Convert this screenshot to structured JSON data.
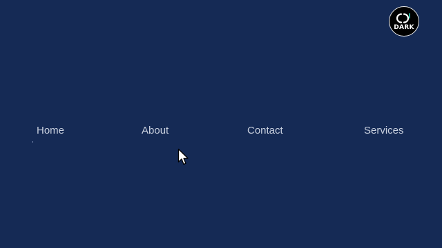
{
  "logo": {
    "text": "DARK",
    "icon": "cd-logo-icon"
  },
  "nav": {
    "items": [
      {
        "label": "Home"
      },
      {
        "label": "About"
      },
      {
        "label": "Contact"
      },
      {
        "label": "Services"
      }
    ]
  },
  "cursor": {
    "icon": "arrow-cursor-icon"
  },
  "colors": {
    "background": "#152a55",
    "nav_text": "#c9d0de",
    "logo_accent": "#2ec4a6"
  }
}
